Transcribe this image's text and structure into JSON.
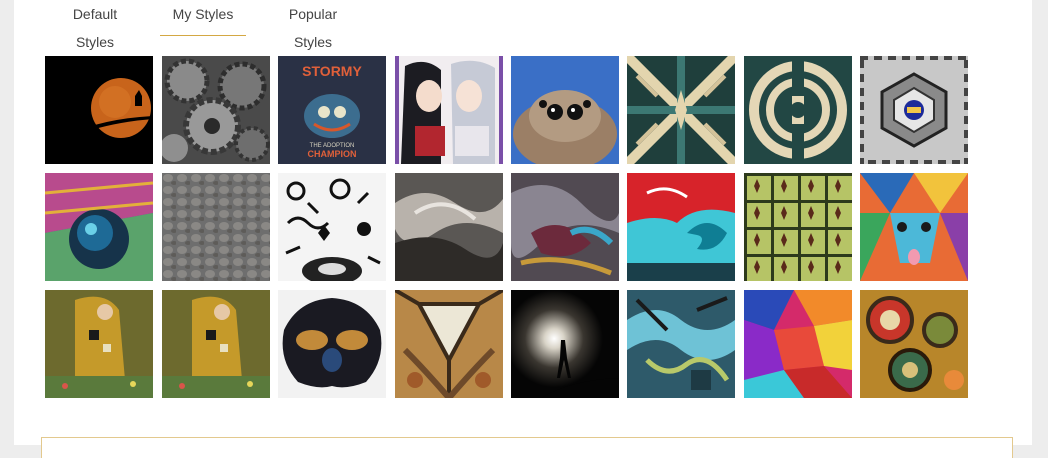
{
  "tabs": [
    {
      "label": "Default Styles",
      "active": false
    },
    {
      "label": "My Styles",
      "active": true
    },
    {
      "label": "Popular Styles",
      "active": false
    }
  ],
  "colors": {
    "accent": "#d4a843",
    "background": "#ededed",
    "panel": "#ffffff"
  },
  "styles": [
    {
      "name": "orange-moon-cat",
      "icon": "moon"
    },
    {
      "name": "metal-gears",
      "icon": "gears"
    },
    {
      "name": "stormy-champion-tshirt",
      "text": [
        "STORMY",
        "THE ADOPTION",
        "CHAMPION"
      ]
    },
    {
      "name": "anime-girls",
      "icon": "anime"
    },
    {
      "name": "jumping-spider",
      "icon": "spider"
    },
    {
      "name": "teal-kaleidoscope",
      "icon": "kaleido"
    },
    {
      "name": "teal-circular-mandala",
      "icon": "mandala"
    },
    {
      "name": "gray-geometric-mandala",
      "icon": "geo"
    },
    {
      "name": "stained-glass-sphere",
      "icon": "sphere"
    },
    {
      "name": "gray-pebbles",
      "icon": "pebbles"
    },
    {
      "name": "doodle-pattern",
      "icon": "doodle"
    },
    {
      "name": "gray-marble-swirl",
      "icon": "marble"
    },
    {
      "name": "psychedelic-swirl",
      "icon": "swirl"
    },
    {
      "name": "red-cyan-wave",
      "icon": "wave"
    },
    {
      "name": "green-tile-grid",
      "icon": "tiles"
    },
    {
      "name": "colorful-poly-bear",
      "icon": "poly"
    },
    {
      "name": "klimt-the-kiss",
      "icon": "kiss"
    },
    {
      "name": "klimt-the-kiss-copy",
      "icon": "kiss"
    },
    {
      "name": "dark-symmetric-rorschach",
      "icon": "rorschach"
    },
    {
      "name": "gold-triangle-mirror",
      "icon": "triangle"
    },
    {
      "name": "silhouette-light",
      "icon": "silhouette"
    },
    {
      "name": "teal-abstract",
      "icon": "abstract"
    },
    {
      "name": "colorful-patchwork",
      "icon": "patch"
    },
    {
      "name": "organic-bubbles",
      "icon": "bubbles"
    }
  ]
}
